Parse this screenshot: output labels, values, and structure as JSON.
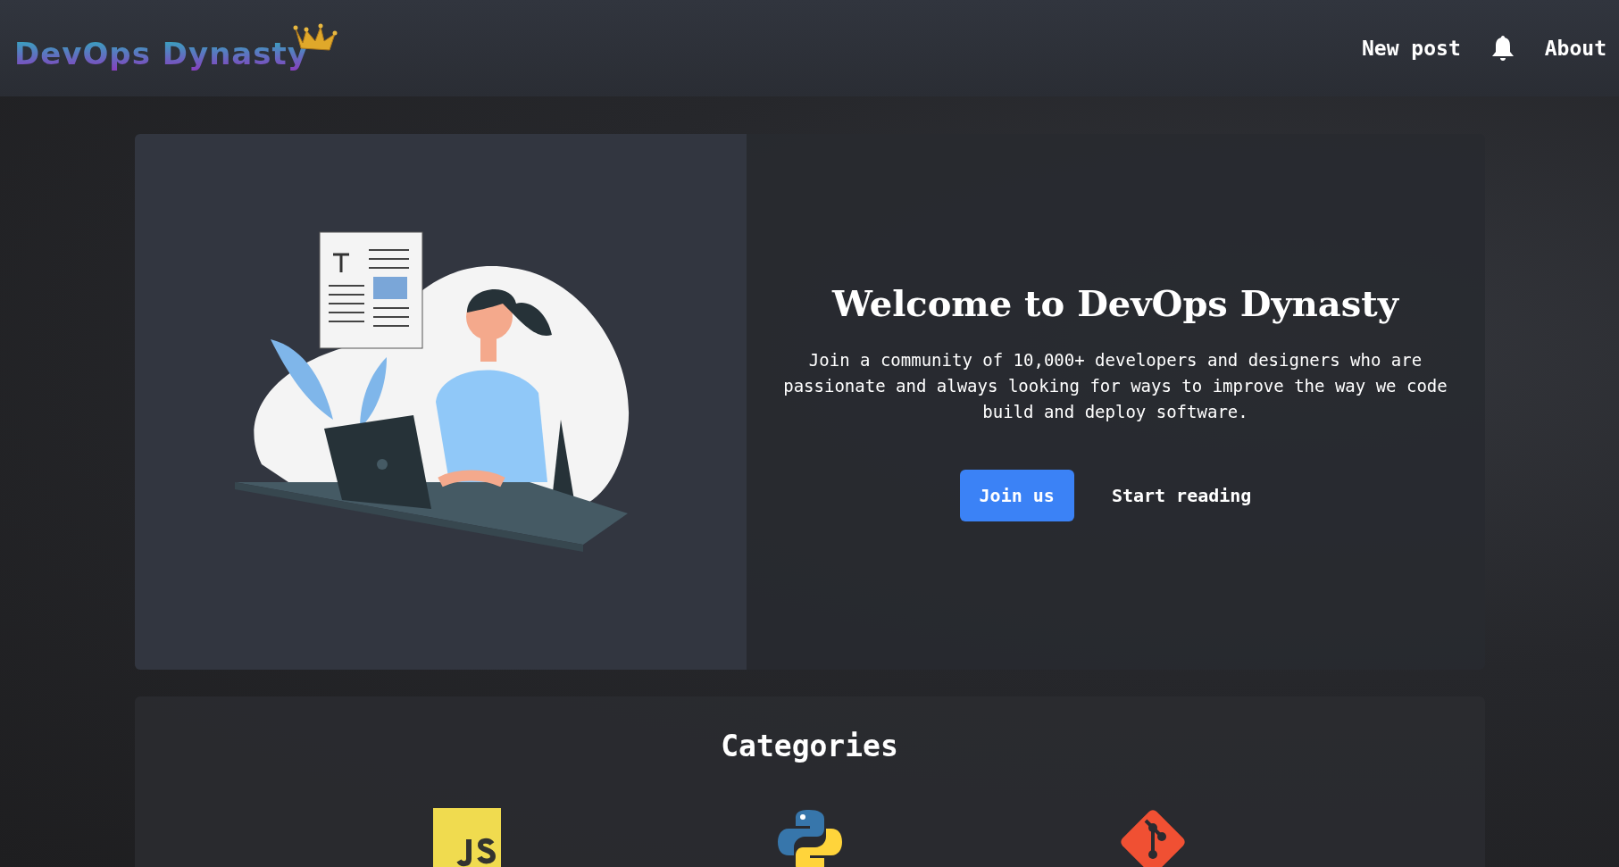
{
  "header": {
    "logo": "DevOps Dynasty",
    "nav": [
      {
        "kind": "link",
        "label": "New post"
      },
      {
        "kind": "bell"
      },
      {
        "kind": "link",
        "label": "About"
      }
    ]
  },
  "hero": {
    "title": "Welcome to DevOps Dynasty",
    "description": "Join a community of 10,000+ developers and designers who are passionate and always looking for ways to improve the way we code build and deploy software.",
    "buttons": [
      {
        "kind": "primary",
        "label": "Join us"
      },
      {
        "kind": "plain",
        "label": "Start reading"
      }
    ]
  },
  "categories": {
    "title": "Categories",
    "items": [
      {
        "kind": "js"
      },
      {
        "kind": "python"
      },
      {
        "kind": "git"
      }
    ]
  }
}
